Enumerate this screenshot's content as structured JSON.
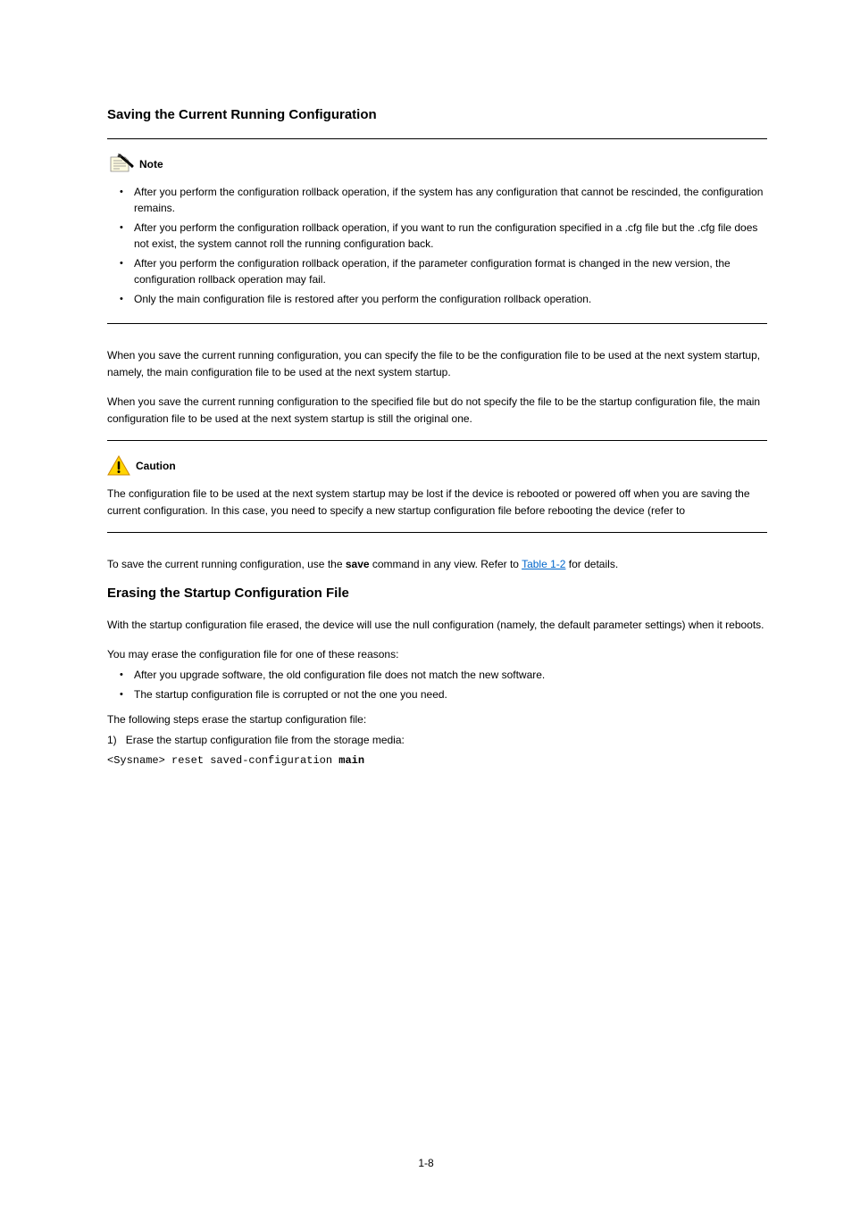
{
  "sections": [
    {
      "heading": "Saving the Current Running Configuration",
      "note": {
        "label": "Note",
        "bullets": [
          "After you perform the configuration rollback operation, if the system has any configuration that cannot be rescinded, the configuration remains.",
          "After you perform the configuration rollback operation, if you want to run the configuration specified in a .cfg file but the .cfg file does not exist, the system cannot roll the running configuration back.",
          "After you perform the configuration rollback operation, if the parameter configuration format is changed in the new version, the configuration rollback operation may fail.",
          "Only the main configuration file is restored after you perform the configuration rollback operation."
        ]
      },
      "paragraphs": [
        "When you save the current running configuration, you can specify the file to be the configuration file to be used at the next system startup, namely, the main configuration file to be used at the next system startup.",
        "When you save the current running configuration to the specified file but do not specify the file to be the startup configuration file, the main configuration file to be used at the next system startup is still the original one."
      ],
      "caution": {
        "label": "Caution",
        "text": "The configuration file to be used at the next system startup may be lost if the device is rebooted or powered off when you are saving the current configuration. In this case, you need to specify a new startup configuration file before rebooting the device (refer to"
      },
      "continuation": {
        "prefix": "To save the current running configuration, use the ",
        "bold": "save",
        "suffix": " command in any view. Refer to ",
        "link": "Table 1-2",
        "end": " for details."
      }
    },
    {
      "heading": "Erasing the Startup Configuration File",
      "intro": "With the startup configuration file erased, the device will use the null configuration (namely, the default parameter settings) when it reboots.",
      "reasons_intro": "You may erase the configuration file for one of these reasons:",
      "reasons": [
        "After you upgrade software, the old configuration file does not match the new software.",
        "The startup configuration file is corrupted or not the one you need."
      ],
      "step_label": "The following steps erase the startup configuration file:",
      "step_num": "1)",
      "step_text": "Erase the startup configuration file from the storage media:",
      "code": "<Sysname> reset saved-configuration",
      "trailing": "main"
    }
  ],
  "page_number": "1-8"
}
